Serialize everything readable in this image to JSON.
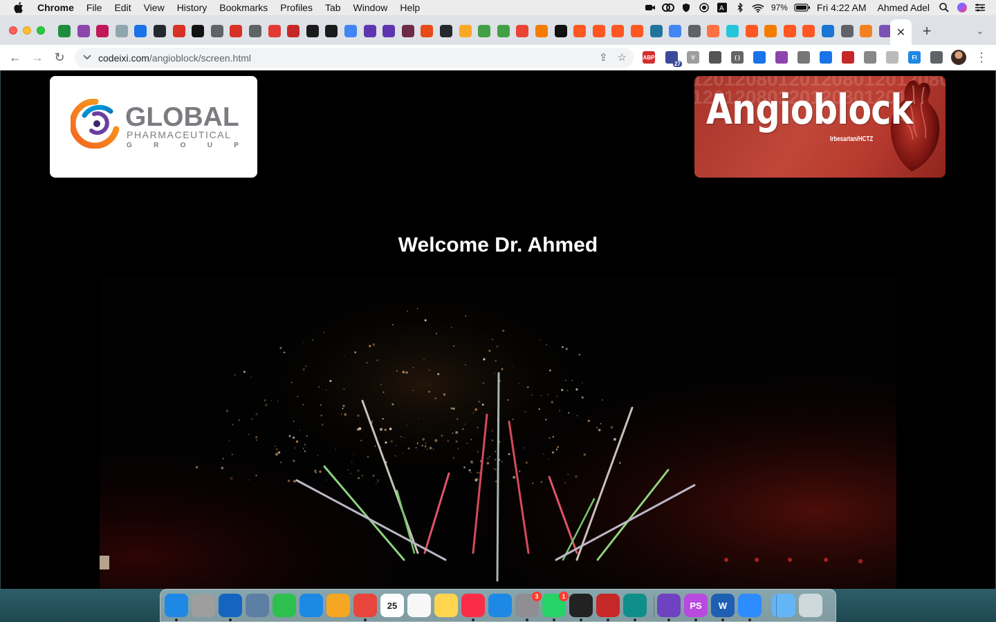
{
  "menubar": {
    "apple_icon": "apple-icon",
    "app_name": "Chrome",
    "menus": [
      "File",
      "Edit",
      "View",
      "History",
      "Bookmarks",
      "Profiles",
      "Tab",
      "Window",
      "Help"
    ],
    "battery_percent": "97%",
    "clock": "Fri 4:22 AM",
    "user_name": "Ahmed Adel",
    "status_icons": [
      "camera-icon",
      "creative-cloud-icon",
      "shield-icon",
      "record-icon",
      "text-input-icon",
      "bluetooth-icon",
      "wifi-icon",
      "battery-icon",
      "search-icon",
      "siri-icon",
      "control-center-icon"
    ]
  },
  "tabs": {
    "pinned_icons": [
      "google-sheets-icon",
      "info-icon",
      "medium-icon",
      "docs-icon",
      "docs-icon",
      "github-icon",
      "pdf-icon",
      "we-icon",
      "globe-icon",
      "pdf-icon",
      "globe-icon",
      "yandex-icon",
      "mt-icon",
      "dark-circle-icon",
      "dark-circle-icon",
      "google-icon",
      "forms-icon",
      "forms-icon",
      "puzzle-icon",
      "camera-icon",
      "github-icon",
      "coin-icon",
      "lightning-icon",
      "lightning-icon",
      "gmail-icon",
      "file-icon",
      "we-icon",
      "link-icon",
      "link-icon",
      "link-icon",
      "link-icon",
      "wordpress-icon",
      "google-icon",
      "globe-icon",
      "flame-icon",
      "swirl-icon",
      "link-icon",
      "pma-icon",
      "link-icon",
      "link-icon",
      "mdb-icon",
      "globe-icon",
      "stack-icon",
      "bootstrap-icon"
    ],
    "close_label": "✕",
    "new_tab_label": "+",
    "tab_search_label": "⌄"
  },
  "toolbar": {
    "back_label": "←",
    "forward_label": "→",
    "reload_label": "↻",
    "url_host": "codeixi.com",
    "url_path": "/angioblock/screen.html",
    "share_label": "⇪",
    "bookmark_label": "☆",
    "extensions": [
      {
        "icon": "adblock-plus-icon",
        "text": "ABP",
        "color": "#d32f2f"
      },
      {
        "icon": "graduation-icon",
        "text": "",
        "color": "#3c4a9a",
        "badge": "27"
      },
      {
        "icon": "vue-devtools-icon",
        "text": "V",
        "color": "#9e9e9e"
      },
      {
        "icon": "eyedropper-icon",
        "text": "",
        "color": "#555555"
      },
      {
        "icon": "code-icon",
        "text": "( )",
        "color": "#666666"
      },
      {
        "icon": "ruler-icon",
        "text": "",
        "color": "#1a73e8"
      },
      {
        "icon": "feather-icon",
        "text": "",
        "color": "#8e44ad"
      },
      {
        "icon": "cloud-link-icon",
        "text": "",
        "color": "#777777"
      },
      {
        "icon": "screen-capture-icon",
        "text": "",
        "color": "#1a73e8"
      },
      {
        "icon": "acrobat-icon",
        "text": "",
        "color": "#c62828"
      },
      {
        "icon": "cloud-icon",
        "text": "",
        "color": "#888888"
      },
      {
        "icon": "grid-icon",
        "text": "",
        "color": "#bbbbbb"
      },
      {
        "icon": "fi-icon",
        "text": "FI",
        "color": "#1e88e5"
      },
      {
        "icon": "puzzle-icon",
        "text": "",
        "color": "#5f6368"
      }
    ],
    "menu_label": "⋮"
  },
  "page": {
    "logo": {
      "title": "GLOBAL",
      "subtitle": "PHARMACEUTICAL",
      "group_letters": [
        "G",
        "R",
        "O",
        "U",
        "P"
      ]
    },
    "brand": {
      "name": "Angioblock",
      "subtitle": "Irbesartan/HCTZ",
      "watermark_numbers": "1201208012012080120120801201208012012080120120"
    },
    "welcome_text": "Welcome Dr. Ahmed",
    "colors": {
      "background": "#000000",
      "brand_red": "#b83a2f",
      "text": "#ffffff"
    }
  },
  "dock": {
    "apps": [
      {
        "icon": "finder-icon",
        "color": "#1e88e5",
        "running": true
      },
      {
        "icon": "launchpad-icon",
        "color": "#9e9e9e",
        "running": false
      },
      {
        "icon": "safari-icon",
        "color": "#1565c0",
        "running": true
      },
      {
        "icon": "preview-icon",
        "color": "#5d7fa3",
        "running": false
      },
      {
        "icon": "facetime-icon",
        "color": "#2ec04f",
        "running": false
      },
      {
        "icon": "messages-icon",
        "color": "#1e88e5",
        "running": false
      },
      {
        "icon": "photos-icon",
        "color": "#f5a623",
        "running": false
      },
      {
        "icon": "chrome-icon",
        "color": "#e8453c",
        "running": true
      },
      {
        "icon": "calendar-icon",
        "color": "#ffffff",
        "running": false,
        "text": "25"
      },
      {
        "icon": "reminders-icon",
        "color": "#f7f7f7",
        "running": false
      },
      {
        "icon": "notes-icon",
        "color": "#ffd54f",
        "running": false
      },
      {
        "icon": "music-icon",
        "color": "#fa2d48",
        "running": true
      },
      {
        "icon": "keynote-icon",
        "color": "#1e88e5",
        "running": false
      },
      {
        "icon": "system-preferences-icon",
        "color": "#8e8e93",
        "running": true,
        "badge": "3"
      },
      {
        "icon": "whatsapp-icon",
        "color": "#25d366",
        "running": true,
        "badge": "1"
      },
      {
        "icon": "terminal-icon",
        "color": "#222222",
        "running": true
      },
      {
        "icon": "database-icon",
        "color": "#c62828",
        "running": true
      },
      {
        "icon": "edge-icon",
        "color": "#0e8f8a",
        "running": true
      },
      {
        "icon": "github-desktop-icon",
        "color": "#6f42c1",
        "running": true
      },
      {
        "icon": "phpstorm-icon",
        "color": "#b84ae0",
        "running": true,
        "text": "PS"
      },
      {
        "icon": "word-icon",
        "color": "#1e5fb4",
        "running": true,
        "text": "W"
      },
      {
        "icon": "zoom-icon",
        "color": "#2d8cff",
        "running": true
      },
      {
        "icon": "downloads-folder-icon",
        "color": "#64b5f6",
        "running": false
      },
      {
        "icon": "trash-icon",
        "color": "#cfd8dc",
        "running": false
      }
    ]
  }
}
